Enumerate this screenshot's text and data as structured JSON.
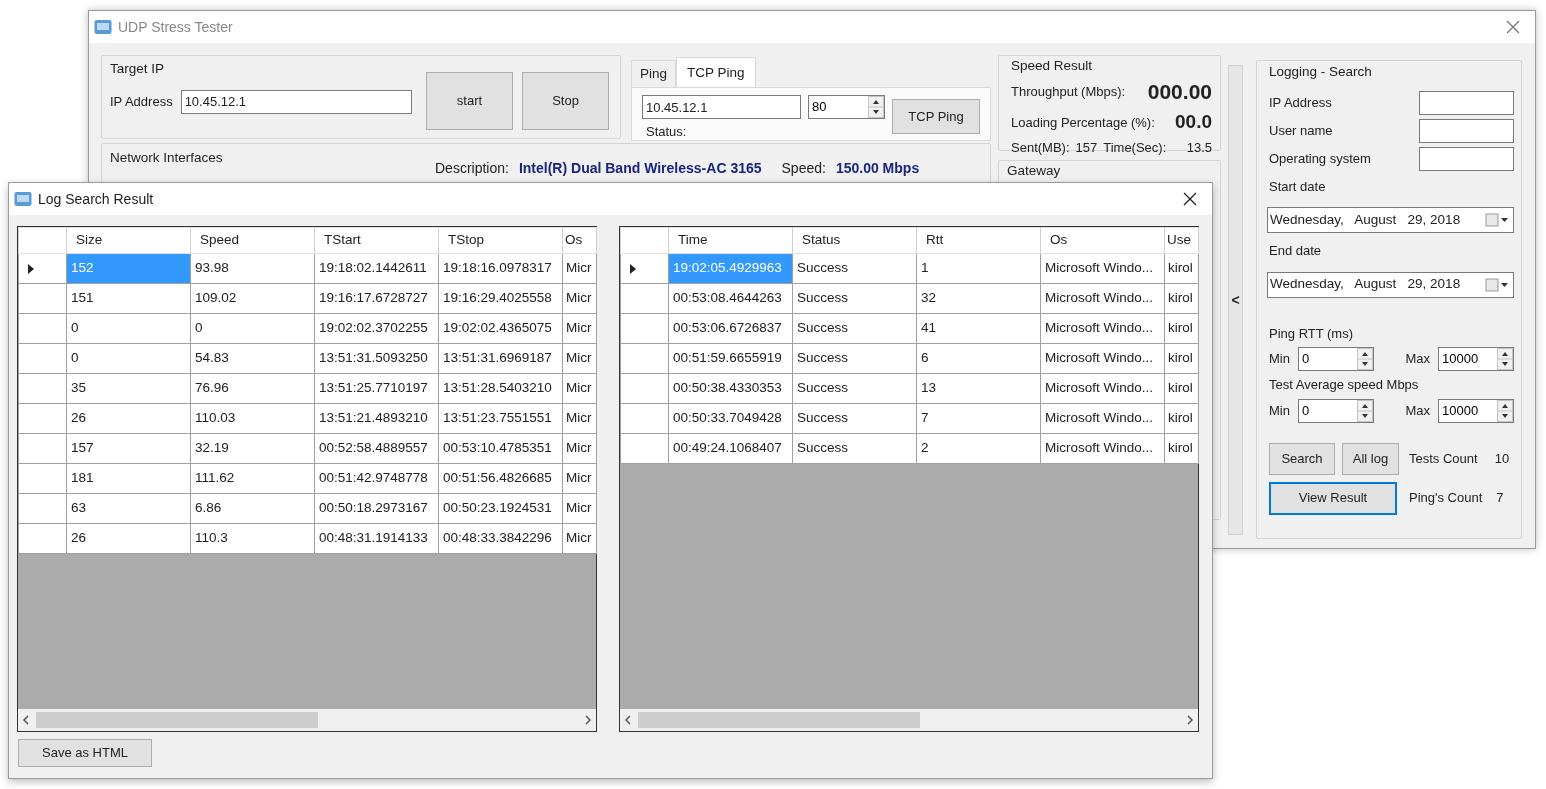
{
  "main_window": {
    "title": "UDP Stress Tester",
    "target_ip": {
      "title": "Target IP",
      "label": "IP Address",
      "value": "10.45.12.1",
      "buttons": [
        "start",
        "Stop"
      ]
    },
    "ping_tabs": {
      "tabs": [
        {
          "label": "Ping",
          "selected": false
        },
        {
          "label": "TCP Ping",
          "selected": true
        }
      ],
      "host": "10.45.12.1",
      "port": "80",
      "button": "TCP Ping",
      "status_label": "Status:"
    },
    "network_interfaces": {
      "title": "Network Interfaces",
      "description_label": "Description:",
      "description": "Intel(R) Dual Band Wireless-AC 3165",
      "speed_label": "Speed:",
      "speed": "150.00 Mbps"
    },
    "speed_result": {
      "title": "Speed Result",
      "throughput_label": "Throughput (Mbps):",
      "throughput": "000.00",
      "loading_label": "Loading Percentage (%):",
      "loading": "00.0",
      "sent_label": "Sent(MB):",
      "sent": "157",
      "time_label": "Time(Sec):",
      "time": "13.5"
    },
    "gateway": {
      "title": "Gateway"
    },
    "collapse_glyph": "<",
    "logging_search": {
      "title": "Logging - Search",
      "fields": [
        {
          "label": "IP Address"
        },
        {
          "label": "User name"
        },
        {
          "label": "Operating system"
        }
      ],
      "start_date": {
        "label": "Start date",
        "value": "Wednesday,   August   29, 2018"
      },
      "end_date": {
        "label": "End date",
        "value": "Wednesday,   August   29, 2018"
      },
      "ping_rtt": {
        "title": "Ping RTT (ms)",
        "min_label": "Min",
        "min": "0",
        "max_label": "Max",
        "max": "10000"
      },
      "avg_speed": {
        "title": "Test Average speed Mbps",
        "min_label": "Min",
        "min": "0",
        "max_label": "Max",
        "max": "10000"
      },
      "buttons": [
        {
          "label": "Search",
          "focused": false
        },
        {
          "label": "All log",
          "focused": false
        },
        {
          "label": "View Result",
          "focused": true
        }
      ],
      "tests_count_label": "Tests Count",
      "tests_count": "10",
      "pings_count_label": "Ping's Count",
      "pings_count": "7"
    }
  },
  "log_window": {
    "title": "Log Search Result",
    "tests_table": {
      "columns": [
        "Size",
        "Speed",
        "TStart",
        "TStop",
        "Os"
      ],
      "rows": [
        {
          "selected": true,
          "cells": [
            "152",
            "93.98",
            "19:18:02.1442611",
            "19:18:16.0978317",
            "Micr"
          ]
        },
        {
          "selected": false,
          "cells": [
            "151",
            "109.02",
            "19:16:17.6728727",
            "19:16:29.4025558",
            "Micr"
          ]
        },
        {
          "selected": false,
          "cells": [
            "0",
            "0",
            "19:02:02.3702255",
            "19:02:02.4365075",
            "Micr"
          ]
        },
        {
          "selected": false,
          "cells": [
            "0",
            "54.83",
            "13:51:31.5093250",
            "13:51:31.6969187",
            "Micr"
          ]
        },
        {
          "selected": false,
          "cells": [
            "35",
            "76.96",
            "13:51:25.7710197",
            "13:51:28.5403210",
            "Micr"
          ]
        },
        {
          "selected": false,
          "cells": [
            "26",
            "110.03",
            "13:51:21.4893210",
            "13:51:23.7551551",
            "Micr"
          ]
        },
        {
          "selected": false,
          "cells": [
            "157",
            "32.19",
            "00:52:58.4889557",
            "00:53:10.4785351",
            "Micr"
          ]
        },
        {
          "selected": false,
          "cells": [
            "181",
            "111.62",
            "00:51:42.9748778",
            "00:51:56.4826685",
            "Micr"
          ]
        },
        {
          "selected": false,
          "cells": [
            "63",
            "6.86",
            "00:50:18.2973167",
            "00:50:23.1924531",
            "Micr"
          ]
        },
        {
          "selected": false,
          "cells": [
            "26",
            "110.3",
            "00:48:31.1914133",
            "00:48:33.3842296",
            "Micr"
          ]
        }
      ]
    },
    "pings_table": {
      "columns": [
        "Time",
        "Status",
        "Rtt",
        "Os",
        "Use"
      ],
      "rows": [
        {
          "selected": true,
          "cells": [
            "19:02:05.4929963",
            "Success",
            "1",
            "Microsoft Windo...",
            "kirol"
          ]
        },
        {
          "selected": false,
          "cells": [
            "00:53:08.4644263",
            "Success",
            "32",
            "Microsoft Windo...",
            "kirol"
          ]
        },
        {
          "selected": false,
          "cells": [
            "00:53:06.6726837",
            "Success",
            "41",
            "Microsoft Windo...",
            "kirol"
          ]
        },
        {
          "selected": false,
          "cells": [
            "00:51:59.6655919",
            "Success",
            "6",
            "Microsoft Windo...",
            "kirol"
          ]
        },
        {
          "selected": false,
          "cells": [
            "00:50:38.4330353",
            "Success",
            "13",
            "Microsoft Windo...",
            "kirol"
          ]
        },
        {
          "selected": false,
          "cells": [
            "00:50:33.7049428",
            "Success",
            "7",
            "Microsoft Windo...",
            "kirol"
          ]
        },
        {
          "selected": false,
          "cells": [
            "00:49:24.1068407",
            "Success",
            "2",
            "Microsoft Windo...",
            "kirol"
          ]
        }
      ]
    },
    "save_button": "Save as HTML"
  }
}
